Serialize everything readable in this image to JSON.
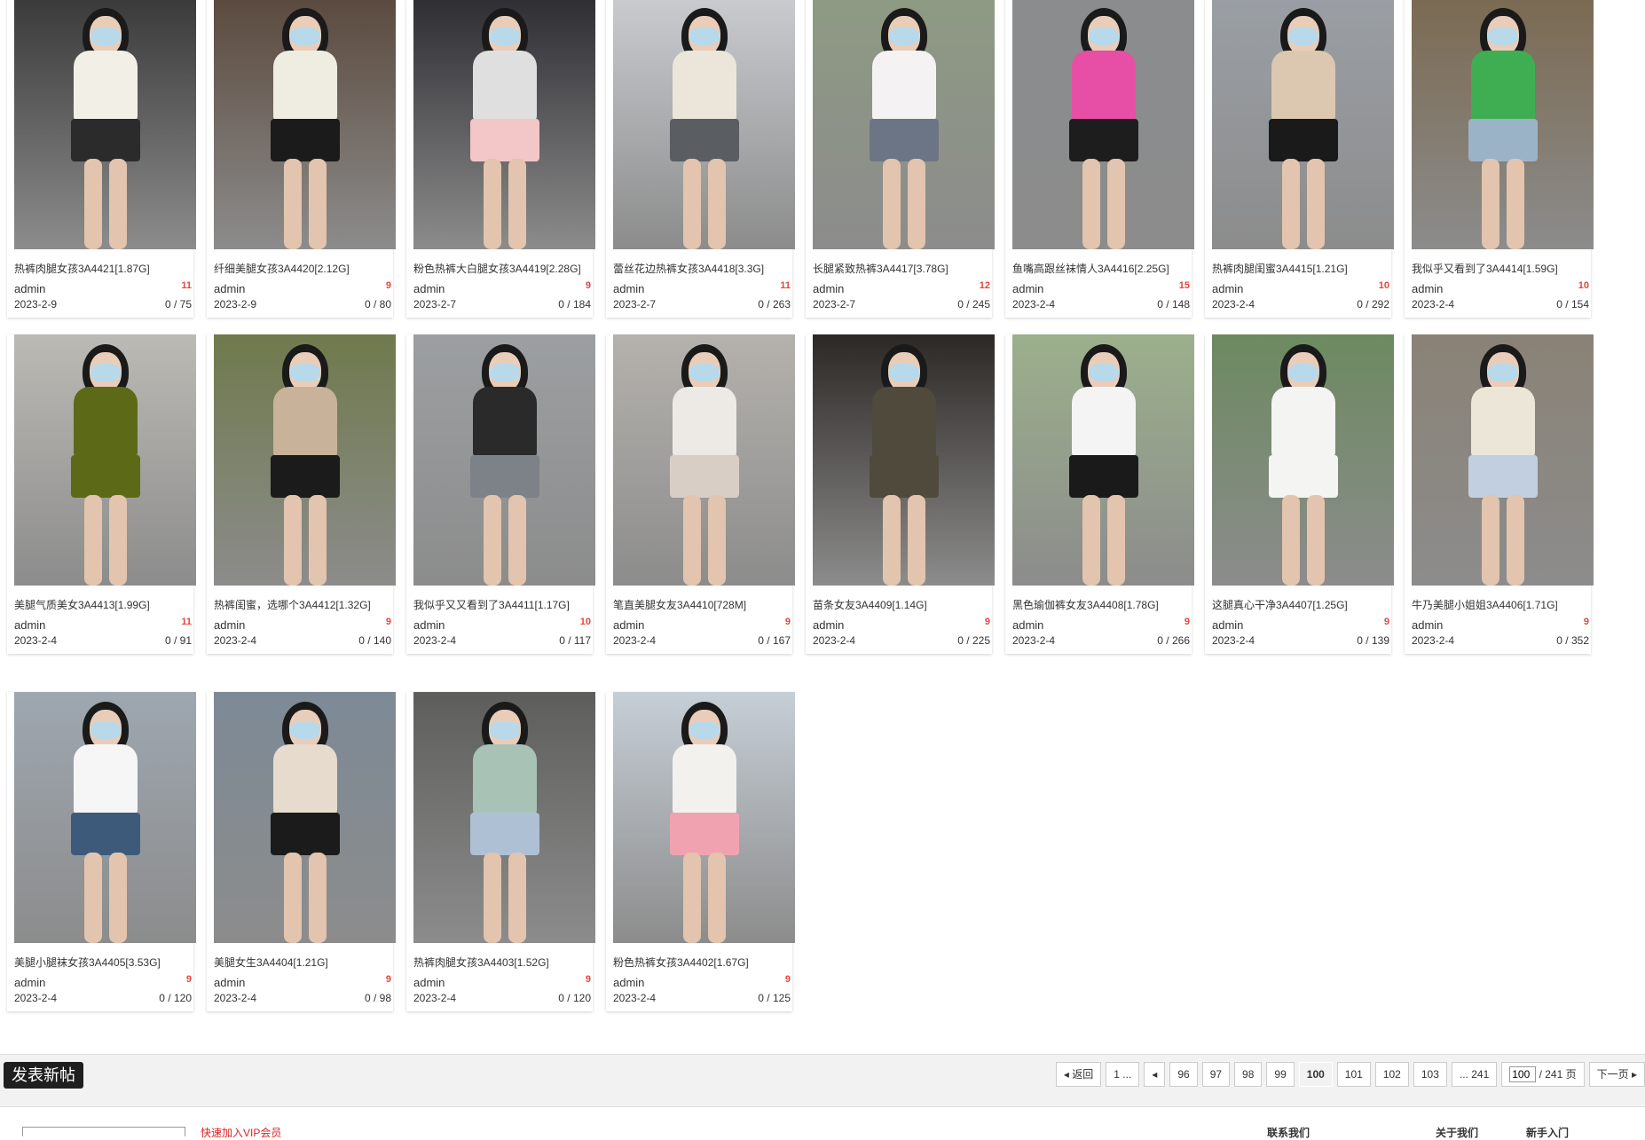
{
  "posts": [
    {
      "title": "热裤肉腿女孩3A4421[1.87G]",
      "author": "admin",
      "replies": "11",
      "date": "2023-2-9",
      "stats": "0 / 75",
      "bg": "#3a3a3a",
      "top": "#f2efe6",
      "bottom": "#2b2b2b"
    },
    {
      "title": "纤细美腿女孩3A4420[2.12G]",
      "author": "admin",
      "replies": "9",
      "date": "2023-2-9",
      "stats": "0 / 80",
      "bg": "#5b4a3e",
      "top": "#efece2",
      "bottom": "#1b1b1b"
    },
    {
      "title": "粉色热裤大白腿女孩3A4419[2.28G]",
      "author": "admin",
      "replies": "9",
      "date": "2023-2-7",
      "stats": "0 / 184",
      "bg": "#2e2e33",
      "top": "#dfdfdf",
      "bottom": "#f3c6c8"
    },
    {
      "title": "蕾丝花边热裤女孩3A4418[3.3G]",
      "author": "admin",
      "replies": "11",
      "date": "2023-2-7",
      "stats": "0 / 263",
      "bg": "#c9cbcf",
      "top": "#ece6da",
      "bottom": "#5a5d62"
    },
    {
      "title": "长腿紧致热裤3A4417[3.78G]",
      "author": "admin",
      "replies": "12",
      "date": "2023-2-7",
      "stats": "0 / 245",
      "bg": "#8e9a83",
      "top": "#f4f2f2",
      "bottom": "#6c7585"
    },
    {
      "title": "鱼嘴高跟丝袜情人3A4416[2.25G]",
      "author": "admin",
      "replies": "15",
      "date": "2023-2-4",
      "stats": "0 / 148",
      "bg": "#8a8c8e",
      "top": "#e64fa5",
      "bottom": "#1d1d1d"
    },
    {
      "title": "热裤肉腿闺蜜3A4415[1.21G]",
      "author": "admin",
      "replies": "10",
      "date": "2023-2-4",
      "stats": "0 / 292",
      "bg": "#9a9fa5",
      "top": "#dcc8b0",
      "bottom": "#1a1a1a"
    },
    {
      "title": "我似乎又看到了3A4414[1.59G]",
      "author": "admin",
      "replies": "10",
      "date": "2023-2-4",
      "stats": "0 / 154",
      "bg": "#7b6a52",
      "top": "#3fae52",
      "bottom": "#9bb3c7"
    },
    {
      "title": "美腿气质美女3A4413[1.99G]",
      "author": "admin",
      "replies": "11",
      "date": "2023-2-4",
      "stats": "0 / 91",
      "bg": "#bcbab4",
      "top": "#5c6a18",
      "bottom": "#5c6a18"
    },
    {
      "title": "热裤闺蜜，选哪个3A4412[1.32G]",
      "author": "admin",
      "replies": "9",
      "date": "2023-2-4",
      "stats": "0 / 140",
      "bg": "#6f7a4c",
      "top": "#c8b29a",
      "bottom": "#1b1b1b"
    },
    {
      "title": "我似乎又又看到了3A4411[1.17G]",
      "author": "admin",
      "replies": "10",
      "date": "2023-2-4",
      "stats": "0 / 117",
      "bg": "#9c9fa1",
      "top": "#2a2a2a",
      "bottom": "#7d8289"
    },
    {
      "title": "笔直美腿女友3A4410[728M]",
      "author": "admin",
      "replies": "9",
      "date": "2023-2-4",
      "stats": "0 / 167",
      "bg": "#b5b2ad",
      "top": "#ede9e4",
      "bottom": "#d9cec6"
    },
    {
      "title": "苗条女友3A4409[1.14G]",
      "author": "admin",
      "replies": "9",
      "date": "2023-2-4",
      "stats": "0 / 225",
      "bg": "#2c2825",
      "top": "#4f4a3c",
      "bottom": "#4f4a3c"
    },
    {
      "title": "黑色瑜伽裤女友3A4408[1.78G]",
      "author": "admin",
      "replies": "9",
      "date": "2023-2-4",
      "stats": "0 / 266",
      "bg": "#9cb08c",
      "top": "#f4f4f4",
      "bottom": "#1a1a1a"
    },
    {
      "title": "这腿真心干净3A4407[1.25G]",
      "author": "admin",
      "replies": "9",
      "date": "2023-2-4",
      "stats": "0 / 139",
      "bg": "#6c8a60",
      "top": "#f4f4f2",
      "bottom": "#f4f4f2"
    },
    {
      "title": "牛乃美腿小姐姐3A4406[1.71G]",
      "author": "admin",
      "replies": "9",
      "date": "2023-2-4",
      "stats": "0 / 352",
      "bg": "#8a8276",
      "top": "#ece6d8",
      "bottom": "#c2cfe0"
    },
    {
      "title": "美腿小腿袜女孩3A4405[3.53G]",
      "author": "admin",
      "replies": "9",
      "date": "2023-2-4",
      "stats": "0 / 120",
      "bg": "#9ea7b0",
      "top": "#f6f6f6",
      "bottom": "#3e5a7a"
    },
    {
      "title": "美腿女生3A4404[1.21G]",
      "author": "admin",
      "replies": "9",
      "date": "2023-2-4",
      "stats": "0 / 98",
      "bg": "#7d8a96",
      "top": "#e6dbcd",
      "bottom": "#1b1b1b"
    },
    {
      "title": "热裤肉腿女孩3A4403[1.52G]",
      "author": "admin",
      "replies": "9",
      "date": "2023-2-4",
      "stats": "0 / 120",
      "bg": "#5d5e5c",
      "top": "#a9c2b6",
      "bottom": "#aec1d4"
    },
    {
      "title": "粉色热裤女孩3A4402[1.67G]",
      "author": "admin",
      "replies": "9",
      "date": "2023-2-4",
      "stats": "0 / 125",
      "bg": "#c6ced6",
      "top": "#f2f1ee",
      "bottom": "#f1a2b0"
    }
  ],
  "toolbar": {
    "new_post_label": "发表新帖"
  },
  "pagination": {
    "back_label": "返回",
    "first_label": "1 ...",
    "pages": [
      "96",
      "97",
      "98",
      "99",
      "100",
      "101",
      "102",
      "103"
    ],
    "current_page": "100",
    "last_label": "... 241",
    "input_value": "100",
    "total_label": "/ 241 页",
    "next_label": "下一页"
  },
  "footer": {
    "red_text": "快速加入VIP会员",
    "links": [
      "联系我们",
      "关于我们",
      "新手入门"
    ]
  },
  "colors": {
    "accent_red": "#e4463a",
    "toolbar_bg": "#1f1f1f"
  }
}
